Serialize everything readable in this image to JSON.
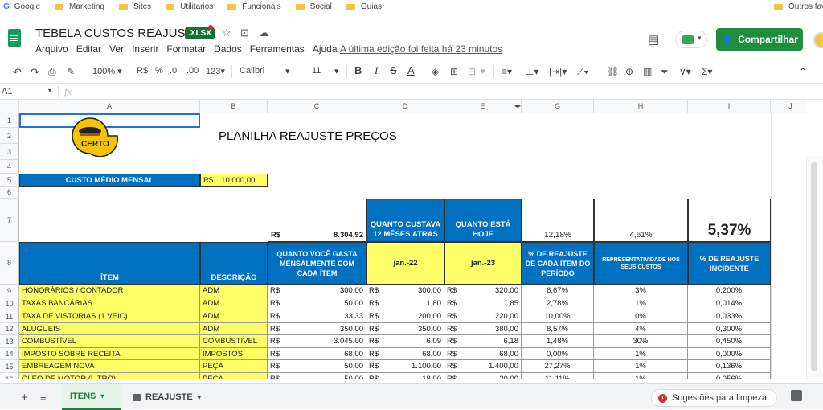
{
  "bookmarks": [
    {
      "label": "Google"
    },
    {
      "label": "Marketing"
    },
    {
      "label": "Sites"
    },
    {
      "label": "Utilitarios"
    },
    {
      "label": "Funcionais"
    },
    {
      "label": "Social"
    },
    {
      "label": "Guias"
    },
    {
      "label": "Outros fav"
    }
  ],
  "doc": {
    "title": "TEBELA CUSTOS REAJUSTE",
    "badge": ".XLSX"
  },
  "menu": [
    "Arquivo",
    "Editar",
    "Ver",
    "Inserir",
    "Formatar",
    "Dados",
    "Ferramentas",
    "Ajuda"
  ],
  "last_edit": "A última edição foi feita há 23 minutos",
  "share_label": "Compartilhar",
  "toolbar": {
    "zoom": "100%",
    "currency": "R$",
    "percent": "%",
    "dec_minus": ".0",
    "dec_plus": ".00",
    "format": "123",
    "font": "Calibri",
    "size": "11"
  },
  "formula": {
    "cell_ref": "A1",
    "fx": "fx"
  },
  "columns": [
    "A",
    "B",
    "C",
    "D",
    "E",
    "F",
    "G",
    "H",
    "I",
    "J"
  ],
  "rows": [
    "1",
    "2",
    "3",
    "4",
    "5",
    "6",
    "7",
    "8",
    "9",
    "10",
    "11",
    "12",
    "13",
    "14",
    "15",
    "16"
  ],
  "sheet": {
    "title": "PLANILHA REAJUSTE PREÇOS",
    "logo_text": "CERTO",
    "custo_label": "CUSTO MÉDIO MENSAL",
    "custo_cur": "R$",
    "custo_value": "10.000,00",
    "r7_cur": "R$",
    "r7_total": "8.304,92",
    "r7_d": "QUANTO CUSTAVA 12 MÊSES ATRAS",
    "r7_e": "QUANTO ESTÁ HOJE",
    "r7_g": "12,18%",
    "r7_h": "4,61%",
    "r7_i": "5,37%",
    "headers": {
      "a": "ÍTEM",
      "b": "DESCRIÇÃO",
      "c": "QUANTO VOCÊ GASTA MENSALMENTE COM CADA ÍTEM",
      "d": "jan.-22",
      "e": "jan.-23",
      "g": "% DE REAJUSTE DE CADA ÍTEM DO PERÍODO",
      "h": "REPRESENTATIVIDADE NOS SEUS CUSTOS",
      "i": "% DE REAJUSTE INCIDENTE"
    },
    "data_rows": [
      {
        "item": "HONORÁRIOS / CONTADOR",
        "desc": "ADM",
        "gasto": "300,00",
        "jan22": "300,00",
        "jan23": "320,00",
        "reaj": "6,67%",
        "repr": "3%",
        "inc": "0,200%"
      },
      {
        "item": "TAXAS BANCÁRIAS",
        "desc": "ADM",
        "gasto": "50,00",
        "jan22": "1,80",
        "jan23": "1,85",
        "reaj": "2,78%",
        "repr": "1%",
        "inc": "0,014%"
      },
      {
        "item": "TAXA DE VISTORIAS (1 VEIC)",
        "desc": "ADM",
        "gasto": "33,33",
        "jan22": "200,00",
        "jan23": "220,00",
        "reaj": "10,00%",
        "repr": "0%",
        "inc": "0,033%"
      },
      {
        "item": "ALUGUEIS",
        "desc": "ADM",
        "gasto": "350,00",
        "jan22": "350,00",
        "jan23": "380,00",
        "reaj": "8,57%",
        "repr": "4%",
        "inc": "0,300%"
      },
      {
        "item": "COMBUSTÍVEL",
        "desc": "COMBUSTIVEL",
        "gasto": "3.045,00",
        "jan22": "6,09",
        "jan23": "6,18",
        "reaj": "1,48%",
        "repr": "30%",
        "inc": "0,450%"
      },
      {
        "item": "IMPOSTO SOBRE RECEITA",
        "desc": "IMPOSTOS",
        "gasto": "68,00",
        "jan22": "68,00",
        "jan23": "68,00",
        "reaj": "0,00%",
        "repr": "1%",
        "inc": "0,000%"
      },
      {
        "item": "EMBREAGEM NOVA",
        "desc": "PEÇA",
        "gasto": "50,00",
        "jan22": "1.100,00",
        "jan23": "1.400,00",
        "reaj": "27,27%",
        "repr": "1%",
        "inc": "0,136%"
      },
      {
        "item": "OLEO DE MOTOR (LITRO)",
        "desc": "PEÇA",
        "gasto": "50,00",
        "jan22": "18,00",
        "jan23": "20,00",
        "reaj": "11,11%",
        "repr": "1%",
        "inc": "0,056%"
      }
    ],
    "currency": "R$"
  },
  "sheet_tabs": [
    {
      "label": "ITENS"
    },
    {
      "label": "REAJUSTE"
    }
  ],
  "suggestion": "Sugestões para limpeza",
  "colors": {
    "blue": "#0070c0",
    "yellow": "#ffff66",
    "share_green": "#1e8e3e",
    "xlsx_green": "#137333"
  }
}
